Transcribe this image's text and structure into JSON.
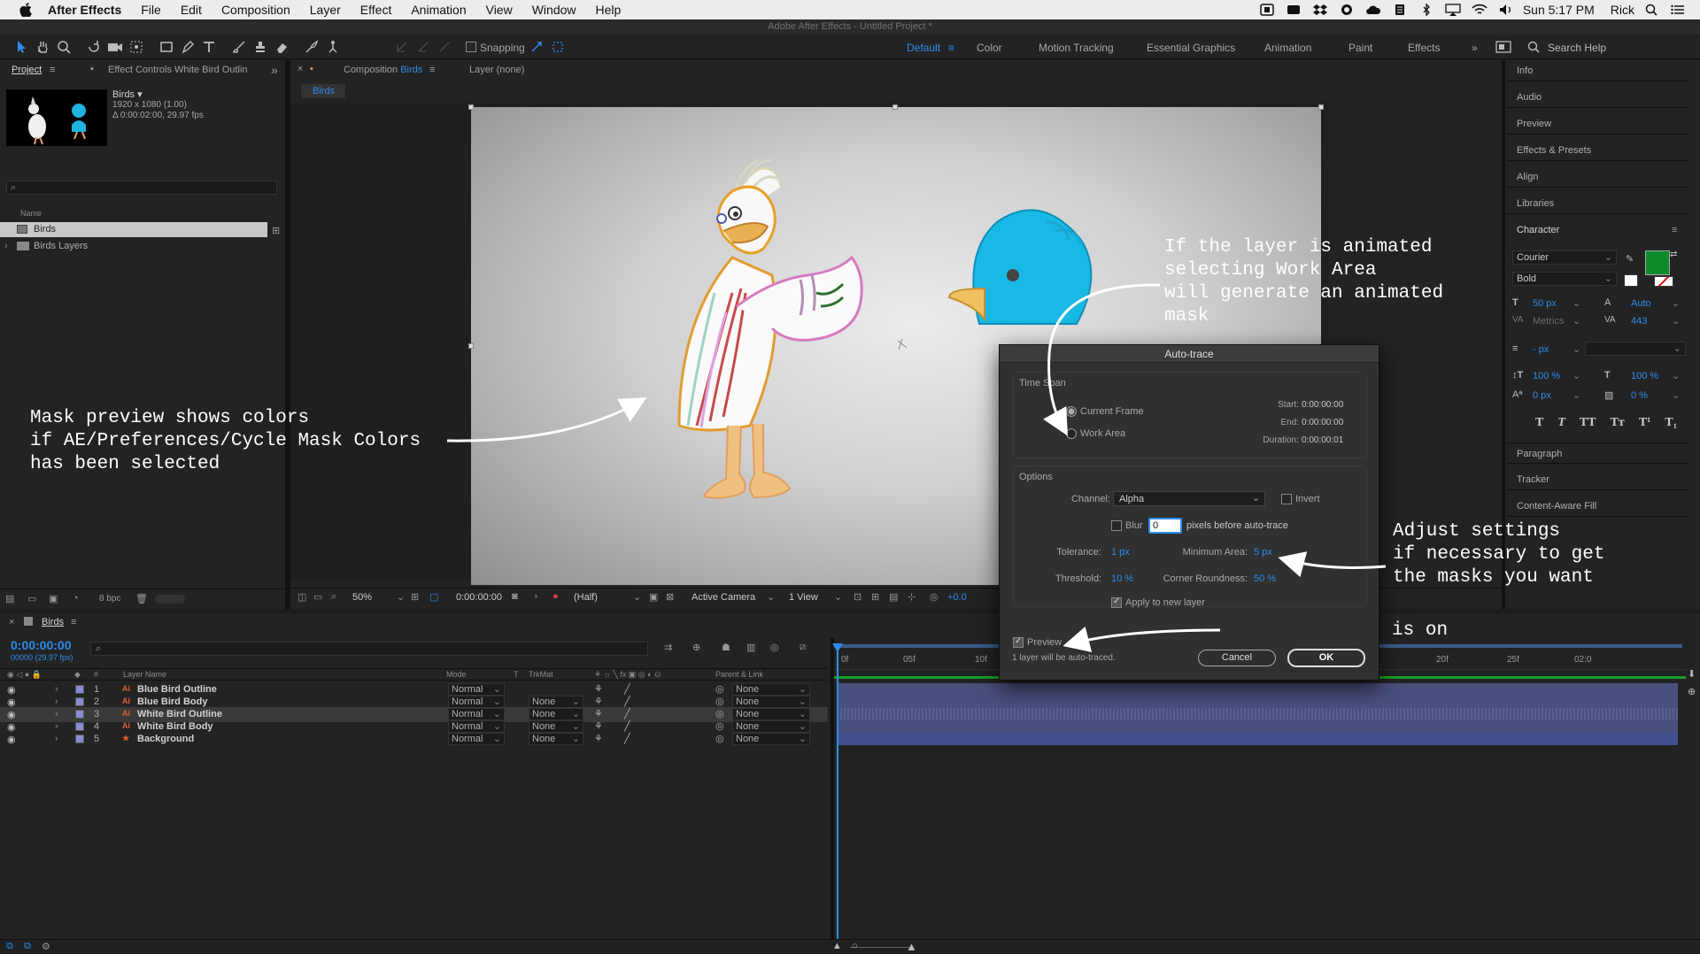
{
  "menubar": {
    "app": "After Effects",
    "items": [
      "File",
      "Edit",
      "Composition",
      "Layer",
      "Effect",
      "Animation",
      "View",
      "Window",
      "Help"
    ],
    "clock": "Sun 5:17 PM",
    "user": "Rick"
  },
  "window_title": "Adobe After Effects - Untitled Project *",
  "toolbar": {
    "snapping": "Snapping",
    "workspaces": [
      "Default",
      "Color",
      "Motion Tracking",
      "Essential Graphics",
      "Animation",
      "Paint",
      "Effects"
    ],
    "active_workspace": "Default",
    "search_help": "Search Help"
  },
  "project_panel": {
    "tab_project": "Project",
    "tab_effect_controls": "Effect Controls White Bird Outlin",
    "comp_name": "Birds ▾",
    "comp_size": "1920 x 1080 (1.00)",
    "comp_duration": "Δ 0:00:02:00, 29.97 fps",
    "col_name": "Name",
    "items": [
      "Birds",
      "Birds Layers"
    ],
    "bpc": "8 bpc"
  },
  "comp_panel": {
    "tab": "Composition",
    "tab_name": "Birds",
    "layer_tab": "Layer (none)",
    "breadcrumb": "Birds",
    "zoom": "50%",
    "timecode": "0:00:00:00",
    "resolution": "(Half)",
    "camera": "Active Camera",
    "views": "1 View",
    "exposure": "+0.0"
  },
  "annotations": {
    "work_area": "If the layer is animated\nselecting Work Area\nwill generate an animated\nmask",
    "mask_preview": "Mask preview shows colors\nif AE/Preferences/Cycle Mask Colors\nhas been selected",
    "adjust": "Adjust settings\nif necessary to get\nthe masks you want",
    "preview_on": "Make sure this is on"
  },
  "dialog": {
    "title": "Auto-trace",
    "time_span": "Time Span",
    "current_frame": "Current Frame",
    "work_area": "Work Area",
    "start_label": "Start:",
    "start": "0:00:00:00",
    "end_label": "End:",
    "end": "0:00:00:00",
    "duration_label": "Duration:",
    "duration": "0:00:00:01",
    "options": "Options",
    "channel_label": "Channel:",
    "channel": "Alpha",
    "invert": "Invert",
    "blur": "Blur",
    "blur_value": "0",
    "blur_suffix": "pixels before auto-trace",
    "tolerance_label": "Tolerance:",
    "tolerance": "1 px",
    "min_area_label": "Minimum Area:",
    "min_area": "5 px",
    "threshold_label": "Threshold:",
    "threshold": "10 %",
    "corner_label": "Corner Roundness:",
    "corner": "50 %",
    "apply_new_layer": "Apply to new layer",
    "preview": "Preview",
    "status": "1 layer will be auto-traced.",
    "cancel": "Cancel",
    "ok": "OK"
  },
  "right_panels": {
    "panels_top": [
      "Info",
      "Audio",
      "Preview",
      "Effects & Presets",
      "Align",
      "Libraries",
      "Character"
    ],
    "panels_bottom": [
      "Paragraph",
      "Tracker",
      "Content-Aware Fill"
    ],
    "font": "Courier",
    "style": "Bold",
    "size": "50 px",
    "leading": "Auto",
    "kerning": "Metrics",
    "tracking": "443",
    "stroke": "- px",
    "vscale": "100 %",
    "hscale": "100 %",
    "baseline": "0 px",
    "tsume": "0 %",
    "fill_color": "#0a8a2a"
  },
  "timeline": {
    "tab": "Birds",
    "timecode": "0:00:00:00",
    "frame_info": "00000 (29.97 fps)",
    "headers": {
      "name": "Layer Name",
      "mode": "Mode",
      "t": "T",
      "trkmat": "TrkMat",
      "parent": "Parent & Link"
    },
    "ruler": [
      "0f",
      "05f",
      "10f",
      "15f",
      "20f",
      "25f",
      "02:0"
    ],
    "layers": [
      {
        "num": "1",
        "name": "Blue Bird Outline",
        "mode": "Normal",
        "trkmat": "",
        "parent": "None"
      },
      {
        "num": "2",
        "name": "Blue Bird Body",
        "mode": "Normal",
        "trkmat": "None",
        "parent": "None"
      },
      {
        "num": "3",
        "name": "White Bird Outline",
        "mode": "Normal",
        "trkmat": "None",
        "parent": "None"
      },
      {
        "num": "4",
        "name": "White Bird Body",
        "mode": "Normal",
        "trkmat": "None",
        "parent": "None"
      },
      {
        "num": "5",
        "name": "Background",
        "mode": "Normal",
        "trkmat": "None",
        "parent": "None"
      }
    ]
  }
}
